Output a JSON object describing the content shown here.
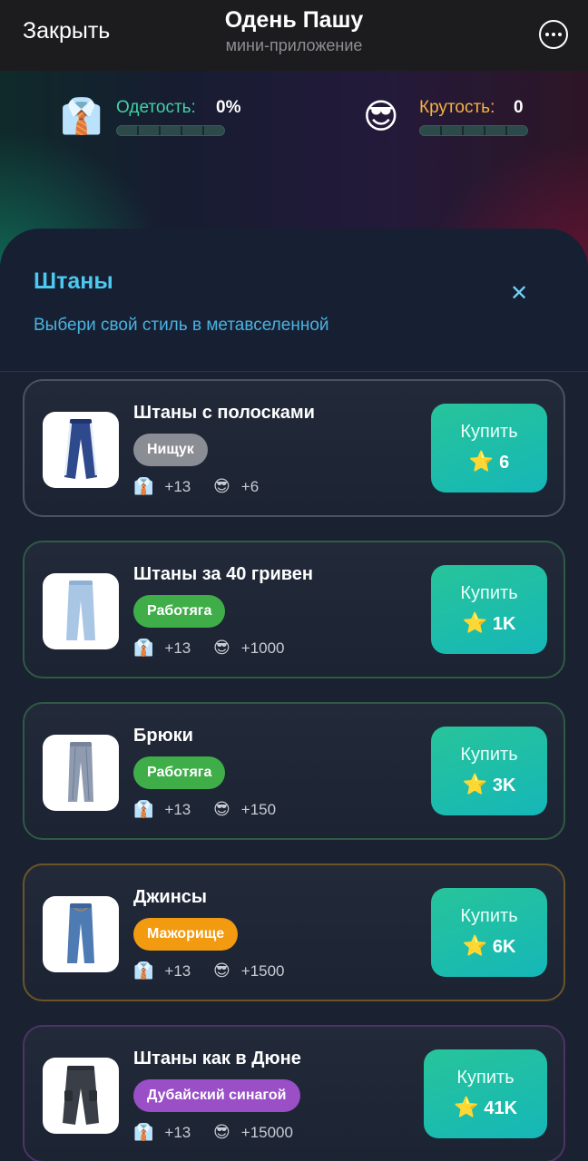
{
  "header": {
    "close_label": "Закрыть",
    "title": "Одень Пашу",
    "subtitle": "мини-приложение",
    "more_icon": "more-circle-icon"
  },
  "stats": {
    "dressed": {
      "icon": "shirt-tie-icon",
      "emoji": "👔",
      "label": "Одетость:",
      "value": "0%",
      "progress": 0,
      "label_color": "#3fd3a4"
    },
    "cool": {
      "icon": "sunglasses-face-icon",
      "emoji": "😎",
      "label": "Крутость:",
      "value": "0",
      "progress": 0,
      "label_color": "#f5b342"
    }
  },
  "panel": {
    "title": "Штаны",
    "subtitle": "Выбери свой стиль в метавселенной",
    "close_icon": "close-icon",
    "close_glyph": "✕"
  },
  "items": [
    {
      "name": "Штаны с полосками",
      "tier": "Нищук",
      "tier_color": "#8a8d93",
      "border_color": "#4a5364",
      "dressed_bonus": "+13",
      "cool_bonus": "+6",
      "buy_label": "Купить",
      "price": "6",
      "image": "striped-pants"
    },
    {
      "name": "Штаны за 40 гривен",
      "tier": "Работяга",
      "tier_color": "#3fae49",
      "border_color": "#2f5a45",
      "dressed_bonus": "+13",
      "cool_bonus": "+1000",
      "buy_label": "Купить",
      "price": "1K",
      "image": "light-pants"
    },
    {
      "name": "Брюки",
      "tier": "Работяга",
      "tier_color": "#3fae49",
      "border_color": "#2f5a45",
      "dressed_bonus": "+13",
      "cool_bonus": "+150",
      "buy_label": "Купить",
      "price": "3K",
      "image": "trousers"
    },
    {
      "name": "Джинсы",
      "tier": "Мажорище",
      "tier_color": "#f29a10",
      "border_color": "#6b5526",
      "dressed_bonus": "+13",
      "cool_bonus": "+1500",
      "buy_label": "Купить",
      "price": "6K",
      "image": "jeans"
    },
    {
      "name": "Штаны как в Дюне",
      "tier": "Дубайский синагой",
      "tier_color": "#9a4fc7",
      "border_color": "#4d3366",
      "dressed_bonus": "+13",
      "cool_bonus": "+15000",
      "buy_label": "Купить",
      "price": "41K",
      "image": "cargo-pants"
    }
  ],
  "icons": {
    "dressed_emoji": "👔",
    "cool_emoji": "😎",
    "star_emoji": "⭐"
  }
}
